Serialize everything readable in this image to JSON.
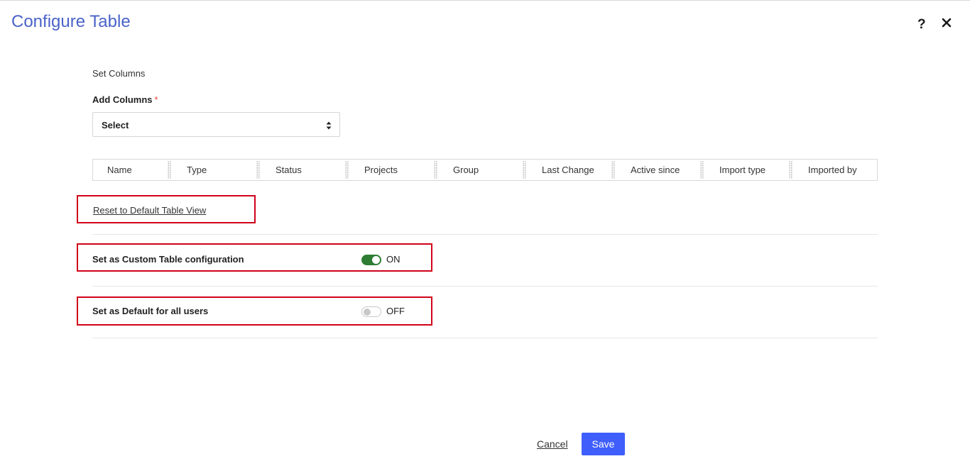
{
  "dialog": {
    "title": "Configure Table",
    "help_label": "?"
  },
  "section": {
    "label": "Set Columns"
  },
  "add_columns": {
    "label": "Add Columns",
    "required_mark": "*",
    "selected_value": "Select"
  },
  "columns": [
    "Name",
    "Type",
    "Status",
    "Projects",
    "Group",
    "Last Change",
    "Active since",
    "Import type",
    "Imported by"
  ],
  "reset": {
    "label": "Reset to Default Table View"
  },
  "custom_config": {
    "label": "Set as Custom Table configuration",
    "state": "ON"
  },
  "default_all": {
    "label": "Set as Default for all users",
    "state": "OFF"
  },
  "footer": {
    "cancel_label": "Cancel",
    "save_label": "Save"
  },
  "colors": {
    "title": "#4a63c9",
    "primary_button": "#3f5efb",
    "toggle_on": "#2e7d32",
    "highlight_box": "#d0021b",
    "required": "#e0443c"
  },
  "icons": {
    "help": "help-icon",
    "close": "close-icon",
    "select_arrows": "sort-arrows-icon",
    "column_grip": "drag-grip-icon"
  }
}
